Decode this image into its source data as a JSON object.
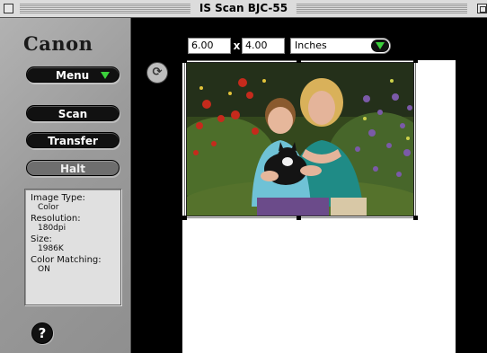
{
  "window": {
    "title": "IS Scan BJC-55"
  },
  "brand": {
    "logo_text": "Canon"
  },
  "buttons": {
    "menu": "Menu",
    "scan": "Scan",
    "transfer": "Transfer",
    "halt": "Halt",
    "help": "?"
  },
  "info": {
    "image_type_label": "Image Type:",
    "image_type_value": "Color",
    "resolution_label": "Resolution:",
    "resolution_value": "180dpi",
    "size_label": "Size:",
    "size_value": "1986K",
    "color_matching_label": "Color Matching:",
    "color_matching_value": "ON"
  },
  "dimensions": {
    "width": "6.00",
    "height": "4.00",
    "separator": "x",
    "units": "Inches"
  },
  "icons": {
    "rotate": "rotate-icon",
    "menu_arrow": "triangle-down-icon",
    "units_arrow": "triangle-down-icon"
  },
  "colors": {
    "accent_green": "#3bd13b",
    "workarea": "#000000",
    "panel": "#9b9b9b"
  }
}
